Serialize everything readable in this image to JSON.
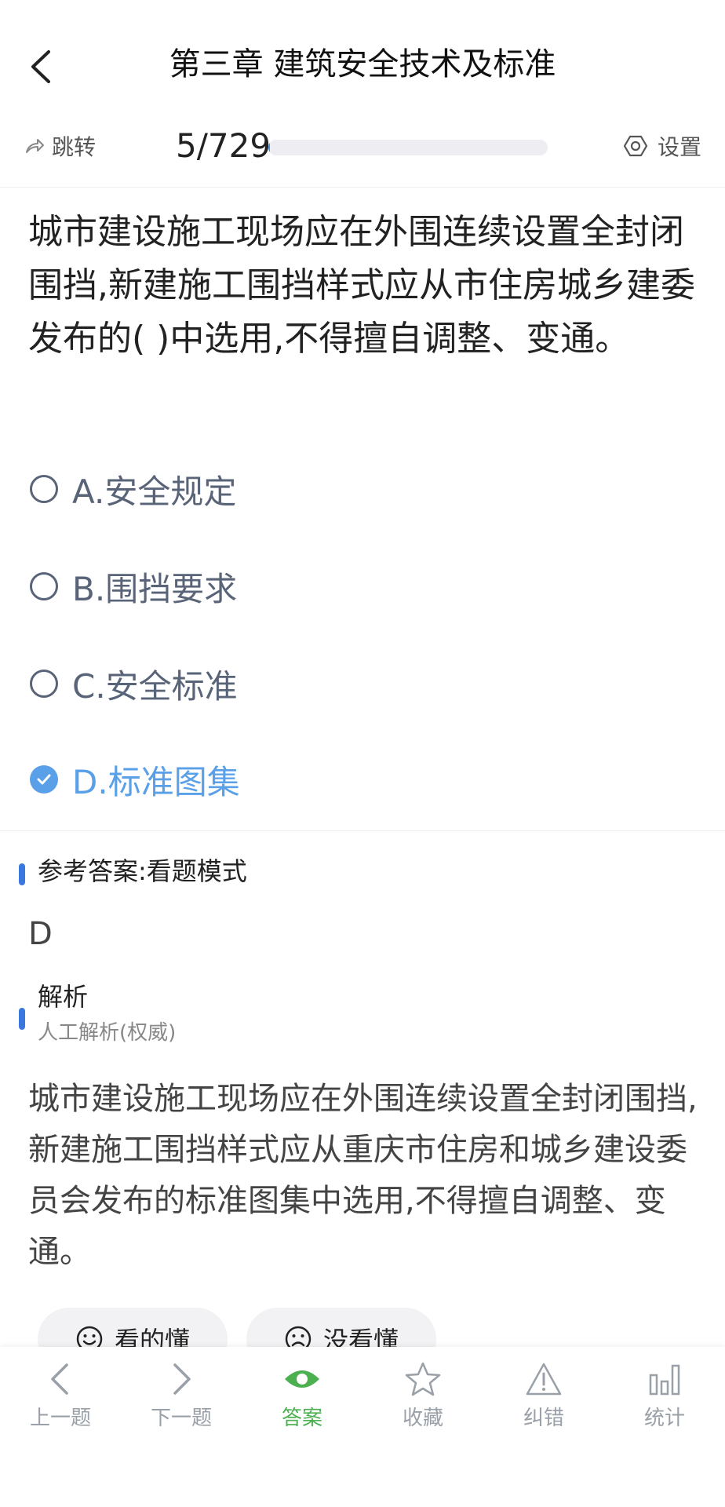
{
  "header": {
    "title": "第三章 建筑安全技术及标准",
    "back_icon": "back-arrow-icon"
  },
  "toolbar": {
    "jump_label": "跳转",
    "progress_text": "5/729",
    "progress_fraction": 0.007,
    "settings_label": "设置"
  },
  "question": {
    "text": "城市建设施工现场应在外围连续设置全封闭围挡,新建施工围挡样式应从市住房城乡建委发布的( )中选用,不得擅自调整、变通。"
  },
  "options": [
    {
      "label": "A.安全规定",
      "selected": false
    },
    {
      "label": "B.围挡要求",
      "selected": false
    },
    {
      "label": "C.安全标准",
      "selected": false
    },
    {
      "label": "D.标准图集",
      "selected": true
    }
  ],
  "answer": {
    "heading": "参考答案:看题模式",
    "value": "D"
  },
  "analysis": {
    "title": "解析",
    "subtitle": "人工解析(权威)",
    "text": "城市建设施工现场应在外围连续设置全封闭围挡,新建施工围挡样式应从重庆市住房和城乡建设委员会发布的标准图集中选用,不得擅自调整、变通。"
  },
  "feedback": {
    "understood": "看的懂",
    "not_understood": "没看懂"
  },
  "nav": [
    {
      "label": "上一题",
      "icon": "chevron-left-icon",
      "active": false
    },
    {
      "label": "下一题",
      "icon": "chevron-right-icon",
      "active": false
    },
    {
      "label": "答案",
      "icon": "eye-icon",
      "active": true
    },
    {
      "label": "收藏",
      "icon": "star-icon",
      "active": false
    },
    {
      "label": "纠错",
      "icon": "warning-icon",
      "active": false
    },
    {
      "label": "统计",
      "icon": "bar-chart-icon",
      "active": false
    }
  ],
  "colors": {
    "accent_blue": "#5aa0e8",
    "bar_blue": "#3a78e0",
    "active_green": "#4caf50"
  }
}
